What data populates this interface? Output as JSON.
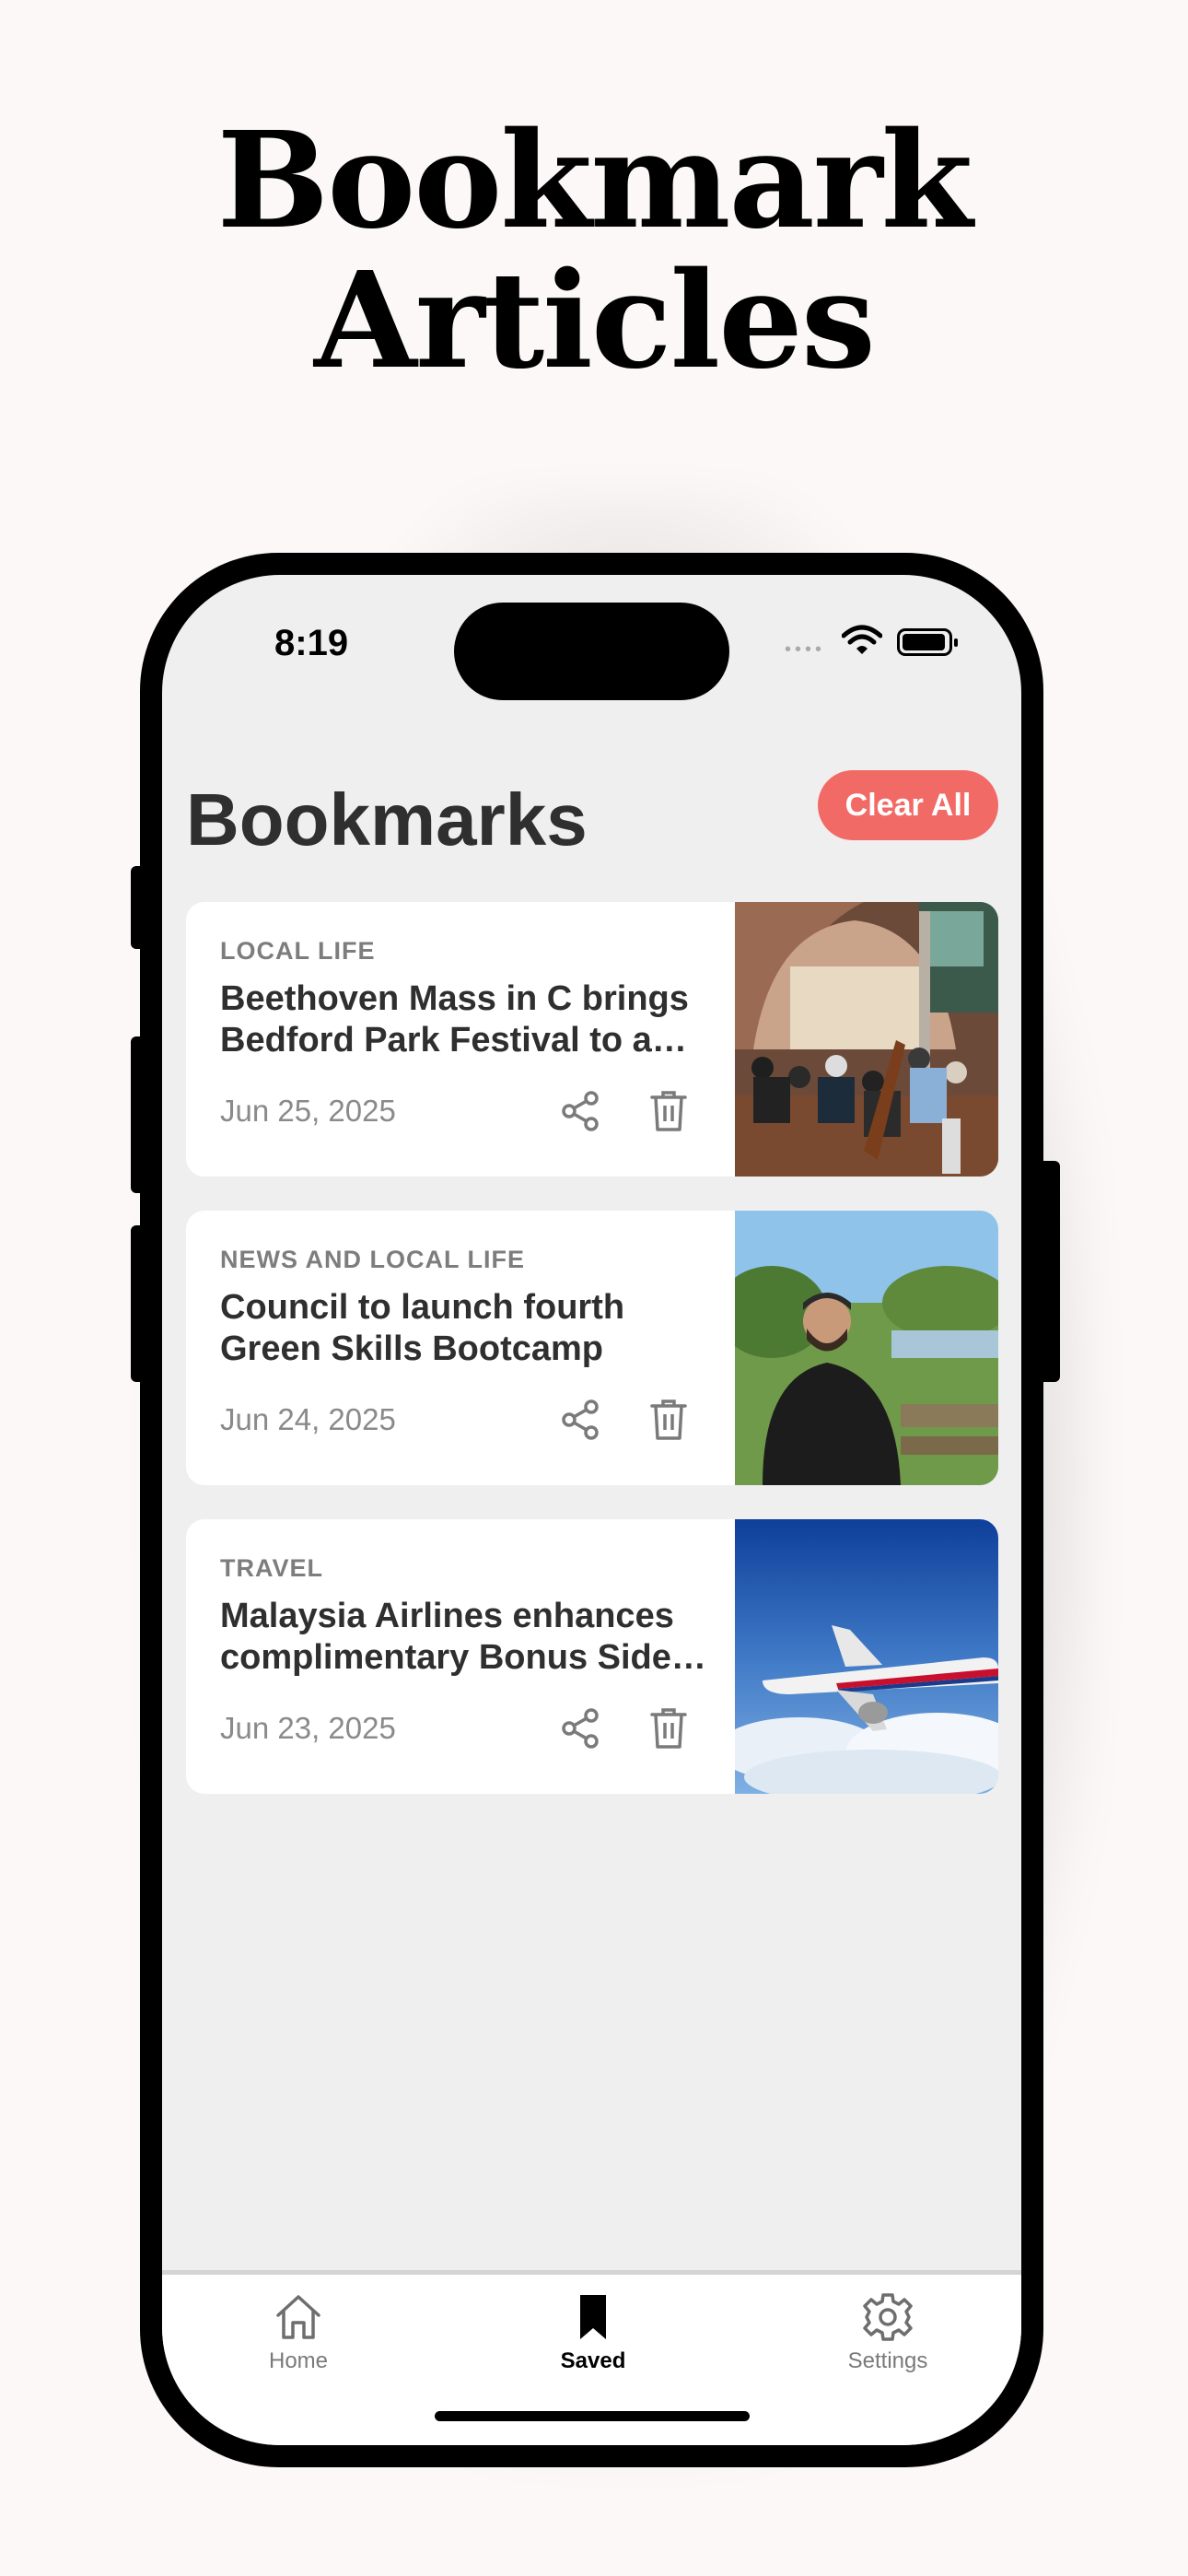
{
  "promo": {
    "line1": "Bookmark",
    "line2": "Articles"
  },
  "status_bar": {
    "time": "8:19",
    "signal": "••••"
  },
  "header": {
    "title": "Bookmarks",
    "clear_all_label": "Clear All"
  },
  "bookmarks": [
    {
      "category": "LOCAL LIFE",
      "title": "Beethoven Mass in C brings Bedford Park Festival to a close",
      "date": "Jun 25, 2025",
      "image": "orchestra-in-church-photo"
    },
    {
      "category": "NEWS AND LOCAL LIFE",
      "title": "Council to launch fourth Green Skills Bootcamp",
      "date": "Jun 24, 2025",
      "image": "man-in-park-photo"
    },
    {
      "category": "TRAVEL",
      "title": "Malaysia Airlines enhances complimentary Bonus Side Trip",
      "date": "Jun 23, 2025",
      "image": "airplane-in-sky-photo"
    }
  ],
  "tabbar": {
    "items": [
      {
        "label": "Home",
        "icon": "house-icon",
        "active": false
      },
      {
        "label": "Saved",
        "icon": "bookmark-icon",
        "active": true
      },
      {
        "label": "Settings",
        "icon": "gear-icon",
        "active": false
      }
    ]
  },
  "colors": {
    "accent": "#f26a66",
    "page_background": "#fcf8f7",
    "screen_background": "#efefef",
    "heading_text": "#2f2f2f",
    "muted_text": "#8a8a8a"
  }
}
